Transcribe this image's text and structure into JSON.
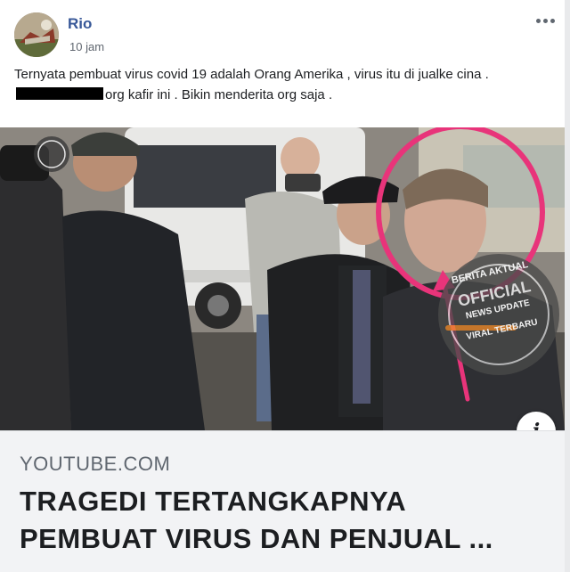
{
  "post": {
    "author": "Rio",
    "time": "10 jam",
    "text_part1": "Ternyata pembuat virus covid 19 adalah Orang Amerika , virus itu di jualke cina .",
    "text_part2": "org kafir ini . Bikin menderita org saja ."
  },
  "media": {
    "watermark_line1": "BERITA AKTUAL",
    "watermark_line2": "OFFICIAL",
    "watermark_line3": "NEWS UPDATE",
    "watermark_line4": "VIRAL TERBARU",
    "info_icon_glyph": "i",
    "highlight_color": "#e8347a"
  },
  "link_preview": {
    "domain": "YOUTUBE.COM",
    "headline_line1": "TRAGEDI TERTANGKAPNYA",
    "headline_line2": "PEMBUAT VIRUS DAN PENJUAL ..."
  },
  "icons": {
    "more": "more-horizontal-icon",
    "info": "info-icon"
  }
}
